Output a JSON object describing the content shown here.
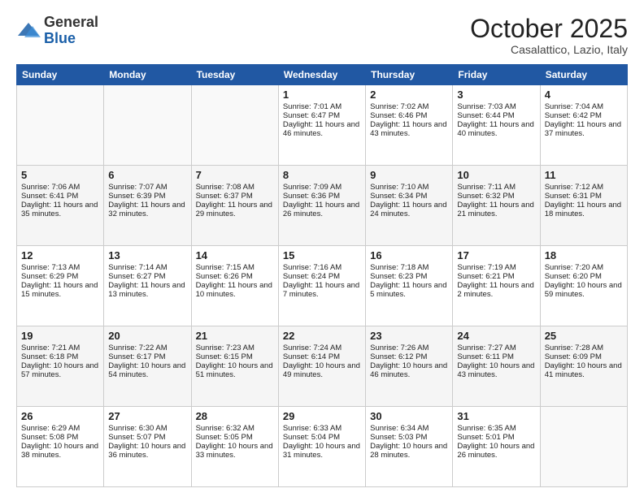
{
  "header": {
    "logo_general": "General",
    "logo_blue": "Blue",
    "month_title": "October 2025",
    "location": "Casalattico, Lazio, Italy"
  },
  "weekdays": [
    "Sunday",
    "Monday",
    "Tuesday",
    "Wednesday",
    "Thursday",
    "Friday",
    "Saturday"
  ],
  "weeks": [
    [
      {
        "day": "",
        "info": ""
      },
      {
        "day": "",
        "info": ""
      },
      {
        "day": "",
        "info": ""
      },
      {
        "day": "1",
        "info": "Sunrise: 7:01 AM\nSunset: 6:47 PM\nDaylight: 11 hours and 46 minutes."
      },
      {
        "day": "2",
        "info": "Sunrise: 7:02 AM\nSunset: 6:46 PM\nDaylight: 11 hours and 43 minutes."
      },
      {
        "day": "3",
        "info": "Sunrise: 7:03 AM\nSunset: 6:44 PM\nDaylight: 11 hours and 40 minutes."
      },
      {
        "day": "4",
        "info": "Sunrise: 7:04 AM\nSunset: 6:42 PM\nDaylight: 11 hours and 37 minutes."
      }
    ],
    [
      {
        "day": "5",
        "info": "Sunrise: 7:06 AM\nSunset: 6:41 PM\nDaylight: 11 hours and 35 minutes."
      },
      {
        "day": "6",
        "info": "Sunrise: 7:07 AM\nSunset: 6:39 PM\nDaylight: 11 hours and 32 minutes."
      },
      {
        "day": "7",
        "info": "Sunrise: 7:08 AM\nSunset: 6:37 PM\nDaylight: 11 hours and 29 minutes."
      },
      {
        "day": "8",
        "info": "Sunrise: 7:09 AM\nSunset: 6:36 PM\nDaylight: 11 hours and 26 minutes."
      },
      {
        "day": "9",
        "info": "Sunrise: 7:10 AM\nSunset: 6:34 PM\nDaylight: 11 hours and 24 minutes."
      },
      {
        "day": "10",
        "info": "Sunrise: 7:11 AM\nSunset: 6:32 PM\nDaylight: 11 hours and 21 minutes."
      },
      {
        "day": "11",
        "info": "Sunrise: 7:12 AM\nSunset: 6:31 PM\nDaylight: 11 hours and 18 minutes."
      }
    ],
    [
      {
        "day": "12",
        "info": "Sunrise: 7:13 AM\nSunset: 6:29 PM\nDaylight: 11 hours and 15 minutes."
      },
      {
        "day": "13",
        "info": "Sunrise: 7:14 AM\nSunset: 6:27 PM\nDaylight: 11 hours and 13 minutes."
      },
      {
        "day": "14",
        "info": "Sunrise: 7:15 AM\nSunset: 6:26 PM\nDaylight: 11 hours and 10 minutes."
      },
      {
        "day": "15",
        "info": "Sunrise: 7:16 AM\nSunset: 6:24 PM\nDaylight: 11 hours and 7 minutes."
      },
      {
        "day": "16",
        "info": "Sunrise: 7:18 AM\nSunset: 6:23 PM\nDaylight: 11 hours and 5 minutes."
      },
      {
        "day": "17",
        "info": "Sunrise: 7:19 AM\nSunset: 6:21 PM\nDaylight: 11 hours and 2 minutes."
      },
      {
        "day": "18",
        "info": "Sunrise: 7:20 AM\nSunset: 6:20 PM\nDaylight: 10 hours and 59 minutes."
      }
    ],
    [
      {
        "day": "19",
        "info": "Sunrise: 7:21 AM\nSunset: 6:18 PM\nDaylight: 10 hours and 57 minutes."
      },
      {
        "day": "20",
        "info": "Sunrise: 7:22 AM\nSunset: 6:17 PM\nDaylight: 10 hours and 54 minutes."
      },
      {
        "day": "21",
        "info": "Sunrise: 7:23 AM\nSunset: 6:15 PM\nDaylight: 10 hours and 51 minutes."
      },
      {
        "day": "22",
        "info": "Sunrise: 7:24 AM\nSunset: 6:14 PM\nDaylight: 10 hours and 49 minutes."
      },
      {
        "day": "23",
        "info": "Sunrise: 7:26 AM\nSunset: 6:12 PM\nDaylight: 10 hours and 46 minutes."
      },
      {
        "day": "24",
        "info": "Sunrise: 7:27 AM\nSunset: 6:11 PM\nDaylight: 10 hours and 43 minutes."
      },
      {
        "day": "25",
        "info": "Sunrise: 7:28 AM\nSunset: 6:09 PM\nDaylight: 10 hours and 41 minutes."
      }
    ],
    [
      {
        "day": "26",
        "info": "Sunrise: 6:29 AM\nSunset: 5:08 PM\nDaylight: 10 hours and 38 minutes."
      },
      {
        "day": "27",
        "info": "Sunrise: 6:30 AM\nSunset: 5:07 PM\nDaylight: 10 hours and 36 minutes."
      },
      {
        "day": "28",
        "info": "Sunrise: 6:32 AM\nSunset: 5:05 PM\nDaylight: 10 hours and 33 minutes."
      },
      {
        "day": "29",
        "info": "Sunrise: 6:33 AM\nSunset: 5:04 PM\nDaylight: 10 hours and 31 minutes."
      },
      {
        "day": "30",
        "info": "Sunrise: 6:34 AM\nSunset: 5:03 PM\nDaylight: 10 hours and 28 minutes."
      },
      {
        "day": "31",
        "info": "Sunrise: 6:35 AM\nSunset: 5:01 PM\nDaylight: 10 hours and 26 minutes."
      },
      {
        "day": "",
        "info": ""
      }
    ]
  ]
}
